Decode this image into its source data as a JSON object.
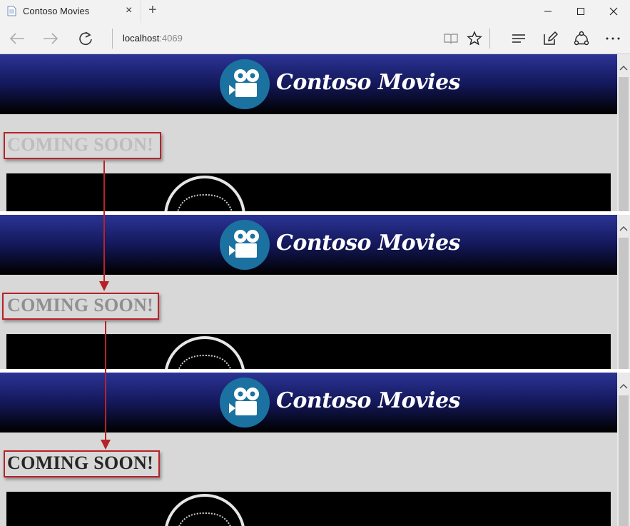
{
  "browser": {
    "tab_title": "Contoso Movies",
    "tab_close": "×",
    "new_tab": "+",
    "url_host": "localhost",
    "url_port": ":4069"
  },
  "page": {
    "brand": "Contoso Movies",
    "coming_soon": "COMING SOON!"
  },
  "frames": [
    {
      "text_color": "#bdbdbd"
    },
    {
      "text_color": "#8f8f8f"
    },
    {
      "text_color": "#252525"
    }
  ],
  "colors": {
    "header_top": "#2b3496",
    "header_bottom": "#000000",
    "logo_circle": "#1b72a0",
    "highlight_red": "#b72229",
    "page_bg": "#d8d8d8"
  }
}
